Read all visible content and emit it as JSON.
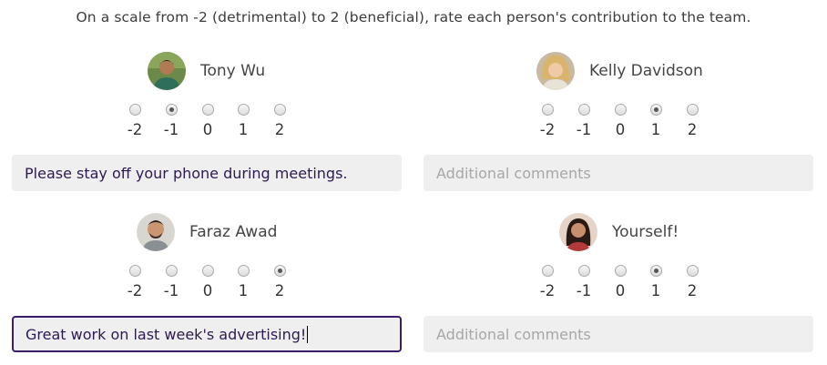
{
  "instructions": "On a scale from -2 (detrimental) to 2 (beneficial), rate each person's contribution to the team.",
  "scale_options": [
    "-2",
    "-1",
    "0",
    "1",
    "2"
  ],
  "people": [
    {
      "name": "Tony Wu",
      "selected": "-1",
      "comment": "Please stay off your phone during meetings.",
      "placeholder": "Additional comments"
    },
    {
      "name": "Kelly Davidson",
      "selected": "1",
      "comment": "",
      "placeholder": "Additional comments"
    },
    {
      "name": "Faraz Awad",
      "selected": "2",
      "comment": "Great work on last week's advertising!",
      "placeholder": "Additional comments"
    },
    {
      "name": "Yourself!",
      "selected": "1",
      "comment": "",
      "placeholder": "Additional comments"
    }
  ],
  "icons": {
    "avatar": "person-photo-icon",
    "radio": "radio-button-icon"
  }
}
